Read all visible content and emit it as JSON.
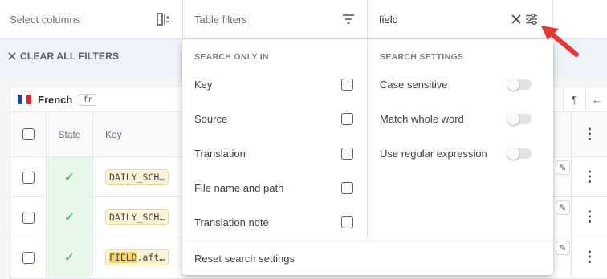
{
  "topbar": {
    "select_columns": "Select columns",
    "table_filters": "Table filters",
    "search_value": "field"
  },
  "clear_all": "CLEAR ALL FILTERS",
  "language": {
    "name": "French",
    "code": "fr"
  },
  "table": {
    "header_state": "State",
    "header_key": "Key",
    "rows": [
      {
        "key_prefix": "",
        "key_match": "",
        "key_rest": "DAILY_SCH…"
      },
      {
        "key_prefix": "",
        "key_match": "",
        "key_rest": "DAILY_SCH…"
      },
      {
        "key_prefix": "",
        "key_match": "FIELD",
        "key_rest": ".aft…"
      }
    ]
  },
  "dropdown": {
    "search_only_in_title": "SEARCH ONLY IN",
    "search_only_in": [
      "Key",
      "Source",
      "Translation",
      "File name and path",
      "Translation note"
    ],
    "search_settings_title": "SEARCH SETTINGS",
    "search_settings": [
      "Case sensitive",
      "Match whole word",
      "Use regular expression"
    ],
    "reset": "Reset search settings"
  },
  "colors": {
    "accent_red": "#e53935",
    "success_green": "#3aa648",
    "highlight": "#f8d56b"
  }
}
